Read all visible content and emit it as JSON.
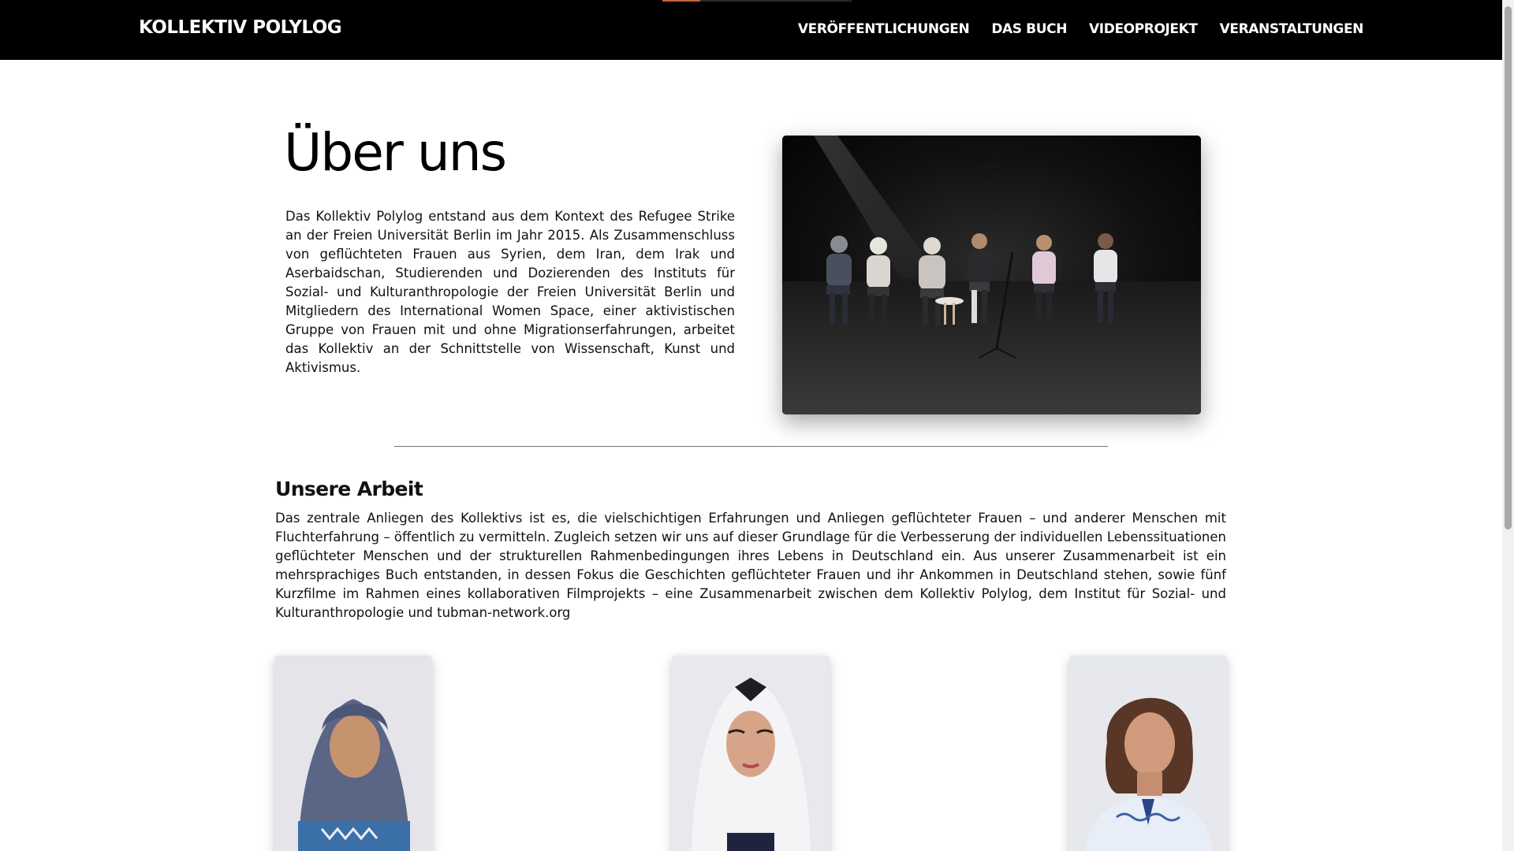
{
  "header": {
    "brand": "KOLLEKTIV POLYLOG",
    "nav": [
      {
        "label": "VERÖFFENTLICHUNGEN"
      },
      {
        "label": "DAS BUCH"
      },
      {
        "label": "VIDEOPROJEKT"
      },
      {
        "label": "VERANSTALTUNGEN"
      }
    ],
    "accent_color": "#c8623a"
  },
  "about": {
    "title": "Über uns",
    "text": "Das Kollektiv Polylog entstand aus dem Kontext des Refugee Strike an der Freien Universität Berlin im Jahr 2015. Als Zusammenschluss von geflüchteten Frauen aus Syrien, dem Iran, dem Irak und Aserbaidschan, Studierenden und Dozierenden des Instituts für Sozial- und Kulturanthropologie der Freien Universität Berlin und Mitgliedern des International Women Space, einer aktivistischen Gruppe von Frauen mit und ohne Migrationserfahrungen, arbeitet das Kollektiv an der Schnittstelle von Wissenschaft, Kunst und Aktivismus."
  },
  "work": {
    "title": "Unsere Arbeit",
    "text": "Das zentrale Anliegen des Kollektivs ist es, die vielschichtigen Erfahrungen und Anliegen geflüchteter Frauen – und anderer Menschen mit Fluchterfahrung – öffentlich zu vermitteln. Zugleich setzen wir uns auf dieser Grundlage für die Verbesserung der individuellen Lebenssituationen geflüchteter Menschen und der strukturellen Rahmenbedingungen ihres Lebens in Deutschland ein. Aus unserer Zusammenarbeit ist ein mehrsprachiges Buch entstanden, in dessen Fokus die Geschichten geflüchteter Frauen und ihr Ankommen in Deutschland stehen, sowie fünf Kurzfilme im Rahmen eines kollaborativen Filmprojekts – eine Zusammenarbeit zwischen dem Kollektiv Polylog, dem Institut für Sozial- und Kulturanthropologie und tubman-network.org"
  }
}
